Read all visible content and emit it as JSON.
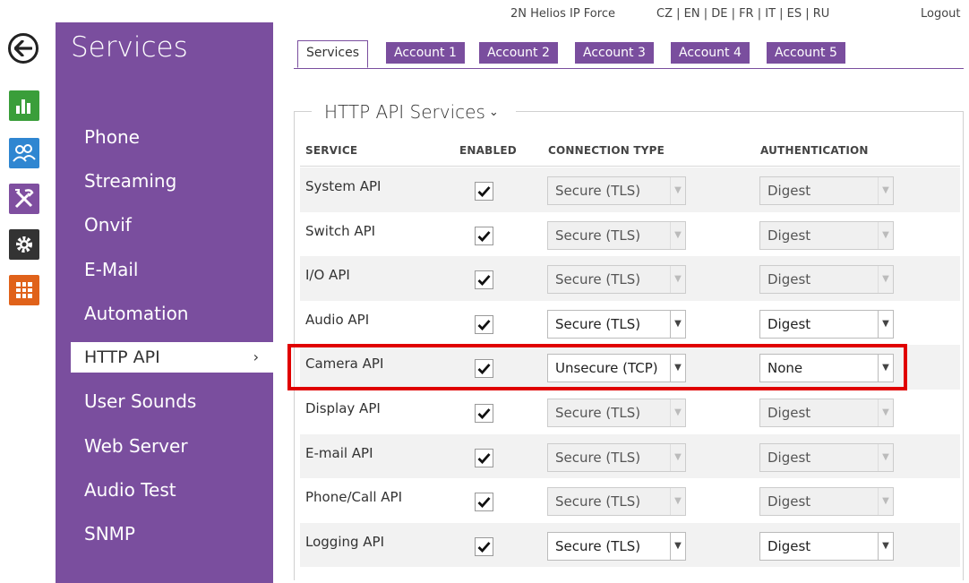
{
  "header": {
    "device_name": "2N Helios IP Force",
    "languages": "CZ | EN | DE | FR | IT | ES | RU",
    "logout": "Logout"
  },
  "sidebar": {
    "title": "Services",
    "items": [
      {
        "label": "Phone"
      },
      {
        "label": "Streaming"
      },
      {
        "label": "Onvif"
      },
      {
        "label": "E-Mail"
      },
      {
        "label": "Automation"
      },
      {
        "label": "HTTP API",
        "active": true
      },
      {
        "label": "User Sounds"
      },
      {
        "label": "Web Server"
      },
      {
        "label": "Audio Test"
      },
      {
        "label": "SNMP"
      }
    ]
  },
  "left_icons": [
    "status-chart-icon",
    "directory-users-icon",
    "hardware-tools-icon",
    "services-gear-icon",
    "system-grid-icon"
  ],
  "tabs": [
    "Services",
    "Account 1",
    "Account 2",
    "Account 3",
    "Account 4",
    "Account 5"
  ],
  "section": {
    "title": "HTTP API Services",
    "columns": [
      "SERVICE",
      "ENABLED",
      "CONNECTION TYPE",
      "AUTHENTICATION"
    ],
    "rows": [
      {
        "service": "System API",
        "enabled": true,
        "connection": "Secure (TLS)",
        "auth": "Digest",
        "editable": false
      },
      {
        "service": "Switch API",
        "enabled": true,
        "connection": "Secure (TLS)",
        "auth": "Digest",
        "editable": false
      },
      {
        "service": "I/O API",
        "enabled": true,
        "connection": "Secure (TLS)",
        "auth": "Digest",
        "editable": false
      },
      {
        "service": "Audio API",
        "enabled": true,
        "connection": "Secure (TLS)",
        "auth": "Digest",
        "editable": true
      },
      {
        "service": "Camera API",
        "enabled": true,
        "connection": "Unsecure (TCP)",
        "auth": "None",
        "editable": true
      },
      {
        "service": "Display API",
        "enabled": true,
        "connection": "Secure (TLS)",
        "auth": "Digest",
        "editable": false
      },
      {
        "service": "E-mail API",
        "enabled": true,
        "connection": "Secure (TLS)",
        "auth": "Digest",
        "editable": false
      },
      {
        "service": "Phone/Call API",
        "enabled": true,
        "connection": "Secure (TLS)",
        "auth": "Digest",
        "editable": false
      },
      {
        "service": "Logging API",
        "enabled": true,
        "connection": "Secure (TLS)",
        "auth": "Digest",
        "editable": true
      }
    ]
  },
  "colors": {
    "sidebar_purple": "#7a4e9e",
    "highlight_red": "#e00000"
  }
}
